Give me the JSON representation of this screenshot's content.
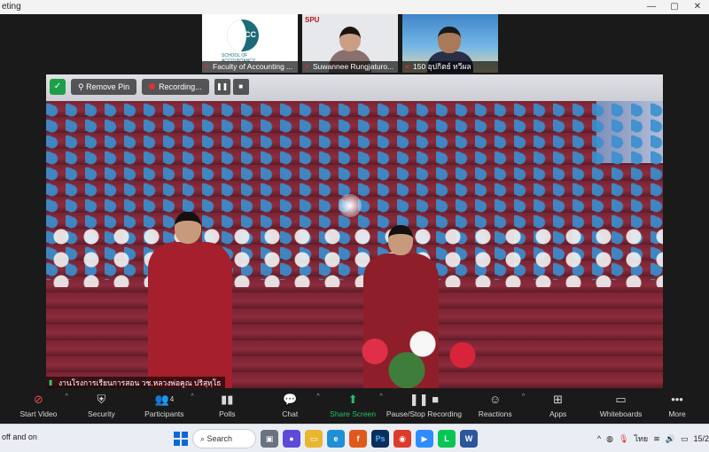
{
  "window": {
    "title": "eting",
    "controls": [
      "—",
      "▢",
      "✕"
    ]
  },
  "participants": [
    {
      "name": "Faculty of Accounting ...",
      "kind": "logo",
      "logo_text": "ACC",
      "logo_sub": "SCHOOL OF ACCOUNTANCY"
    },
    {
      "name": "Suwannee Rungjaturo...",
      "kind": "person",
      "brand": "SPU"
    },
    {
      "name": "150 อุปกิตย์ ทวีผล",
      "kind": "person"
    }
  ],
  "overlay": {
    "remove_pin": "Remove Pin",
    "recording": "Recording...",
    "pause_glyph": "❚❚",
    "stop_glyph": "■",
    "shield_glyph": "✓"
  },
  "speaker_label": "งานโรงการเรียนการสอน วช.หลวงพ่อคูณ ปริสุทฺโธ",
  "toolbar": [
    {
      "label": "Start Video",
      "icon": "video-off-icon",
      "glyph": "⊘",
      "caret": true,
      "style": "red"
    },
    {
      "label": "Security",
      "icon": "shield-icon",
      "glyph": "⛨",
      "caret": false
    },
    {
      "label": "Participants",
      "icon": "participants-icon",
      "glyph": "👥",
      "count": "4",
      "caret": true
    },
    {
      "label": "Polls",
      "icon": "polls-icon",
      "glyph": "▮▮",
      "caret": false
    },
    {
      "label": "Chat",
      "icon": "chat-icon",
      "glyph": "💬",
      "caret": true
    },
    {
      "label": "Share Screen",
      "icon": "share-screen-icon",
      "glyph": "⬆",
      "caret": true,
      "style": "share"
    },
    {
      "label": "Pause/Stop Recording",
      "icon": "recording-icon",
      "glyph": "❚❚ ■",
      "caret": false
    },
    {
      "label": "Reactions",
      "icon": "reactions-icon",
      "glyph": "☺",
      "caret": true
    },
    {
      "label": "Apps",
      "icon": "apps-icon",
      "glyph": "⊞",
      "caret": false
    },
    {
      "label": "Whiteboards",
      "icon": "whiteboard-icon",
      "glyph": "▭",
      "caret": false
    },
    {
      "label": "More",
      "icon": "more-icon",
      "glyph": "•••",
      "caret": false
    }
  ],
  "taskbar": {
    "left_text": "off and on",
    "search_label": "Search",
    "language": "ไทย",
    "clock": "15/2"
  },
  "colors": {
    "share": "#23c16b",
    "recording_red": "#e03131",
    "toolbar_bg": "#1a1a1a",
    "taskbar_bg": "#eaedf3"
  }
}
